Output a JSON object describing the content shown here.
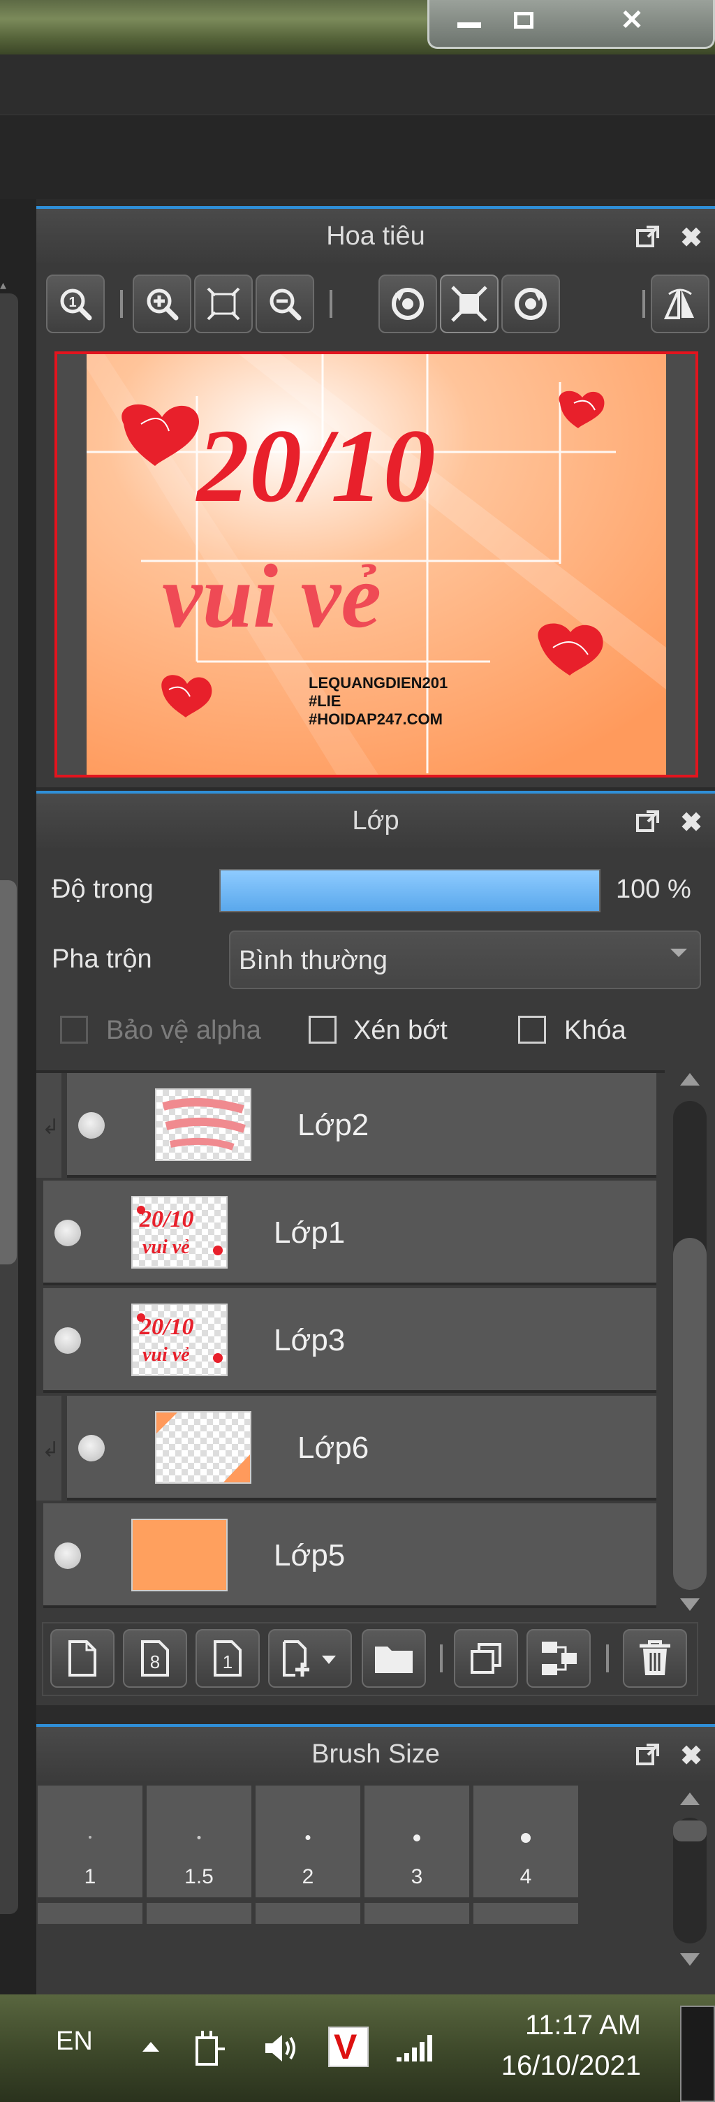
{
  "navigator": {
    "title": "Hoa tiêu",
    "canvas_text": {
      "big_line_1": "20/10",
      "big_line_2": "vui vẻ",
      "credit_1": "LEQUANGDIEN201",
      "credit_2": "#LIE",
      "credit_3": "#HOIDAP247.COM"
    },
    "tools": [
      "zoom-actual-icon",
      "zoom-in-icon",
      "fit-screen-icon",
      "zoom-out-icon",
      "rotate-left-icon",
      "rotate-reset-icon",
      "rotate-right-icon",
      "flip-horizontal-icon"
    ]
  },
  "layers": {
    "title": "Lớp",
    "opacity_label": "Độ trong",
    "opacity_value": "100 %",
    "opacity": 1.0,
    "blend_label": "Pha trộn",
    "blend_value": "Bình thường",
    "protect_alpha_label": "Bảo vệ alpha",
    "clip_label": "Xén bớt",
    "lock_label": "Khóa",
    "items": [
      {
        "name": "Lớp2",
        "clipped": true
      },
      {
        "name": "Lớp1",
        "clipped": false
      },
      {
        "name": "Lớp3",
        "clipped": false
      },
      {
        "name": "Lớp6",
        "clipped": true
      },
      {
        "name": "Lớp5",
        "clipped": false
      }
    ],
    "toolbar": [
      "new-layer-icon",
      "new-8bit-layer-icon",
      "new-1bit-layer-icon",
      "add-layer-menu-icon",
      "folder-icon",
      "duplicate-layer-icon",
      "merge-down-icon",
      "trash-icon"
    ]
  },
  "brush_size": {
    "title": "Brush Size",
    "sizes": [
      "1",
      "1.5",
      "2",
      "3",
      "4"
    ]
  },
  "taskbar": {
    "lang": "EN",
    "time": "11:17 AM",
    "date": "16/10/2021"
  },
  "colors": {
    "accent": "#2f8fd8",
    "canvas_bg": "#ffb37a",
    "heart_red": "#e8202b",
    "layer5_fill": "#ffa05e"
  }
}
